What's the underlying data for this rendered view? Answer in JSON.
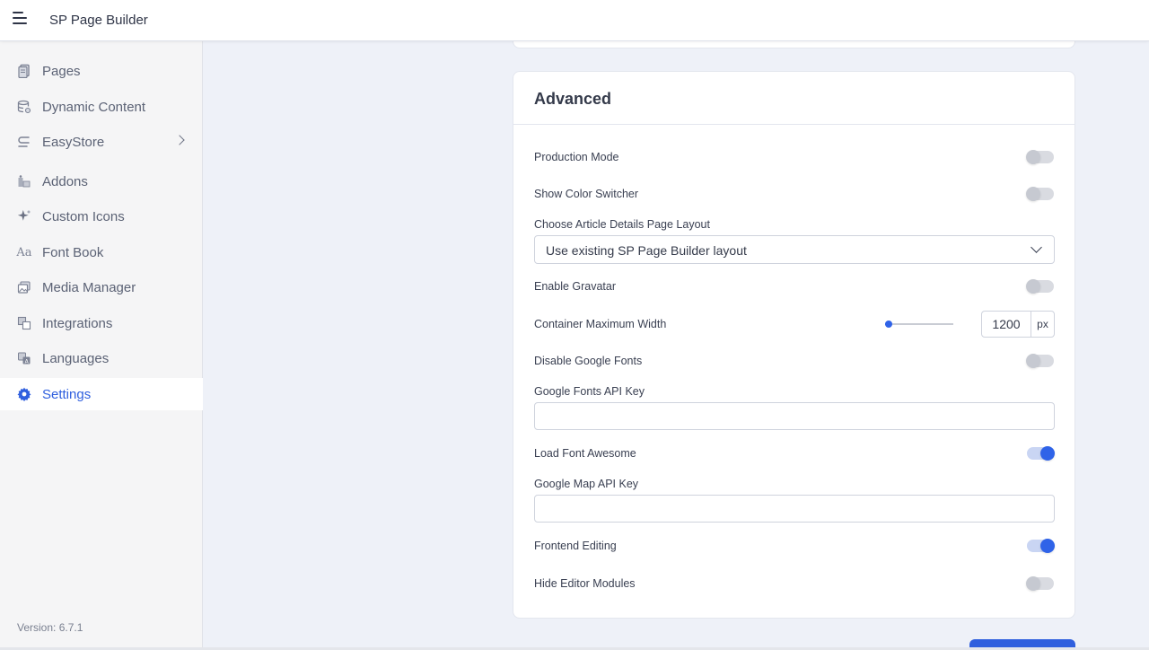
{
  "app": {
    "title": "SP Page Builder"
  },
  "sidebar": {
    "items": [
      {
        "label": "Pages",
        "icon": "pages-icon"
      },
      {
        "label": "Dynamic Content",
        "icon": "database-icon"
      },
      {
        "label": "EasyStore",
        "icon": "easystore-icon"
      },
      {
        "label": "Addons",
        "icon": "addons-icon"
      },
      {
        "label": "Custom Icons",
        "icon": "sparkle-icon"
      },
      {
        "label": "Font Book",
        "icon": "font-icon",
        "glyph": "Aa"
      },
      {
        "label": "Media Manager",
        "icon": "media-icon"
      },
      {
        "label": "Integrations",
        "icon": "integrations-icon"
      },
      {
        "label": "Languages",
        "icon": "languages-icon"
      },
      {
        "label": "Settings",
        "icon": "gear-icon",
        "active": true
      }
    ],
    "version": "Version: 6.7.1"
  },
  "advanced": {
    "title": "Advanced",
    "production_mode": {
      "label": "Production Mode",
      "on": false
    },
    "show_color_switcher": {
      "label": "Show Color Switcher",
      "on": false
    },
    "article_layout": {
      "label": "Choose Article Details Page Layout",
      "value": "Use existing SP Page Builder layout"
    },
    "enable_gravatar": {
      "label": "Enable Gravatar",
      "on": false
    },
    "container_width": {
      "label": "Container Maximum Width",
      "value": "1200",
      "unit": "px",
      "slider_fraction": 0.05
    },
    "disable_google_fonts": {
      "label": "Disable Google Fonts",
      "on": false
    },
    "google_fonts_api_key": {
      "label": "Google Fonts API Key",
      "value": ""
    },
    "load_font_awesome": {
      "label": "Load Font Awesome",
      "on": true
    },
    "google_map_api_key": {
      "label": "Google Map API Key",
      "value": ""
    },
    "frontend_editing": {
      "label": "Frontend Editing",
      "on": true
    },
    "hide_editor_modules": {
      "label": "Hide Editor Modules",
      "on": false
    }
  },
  "colors": {
    "accent": "#2f5fde",
    "toggle_on": "#2f63e8",
    "toggle_off": "#d9dbe1"
  }
}
